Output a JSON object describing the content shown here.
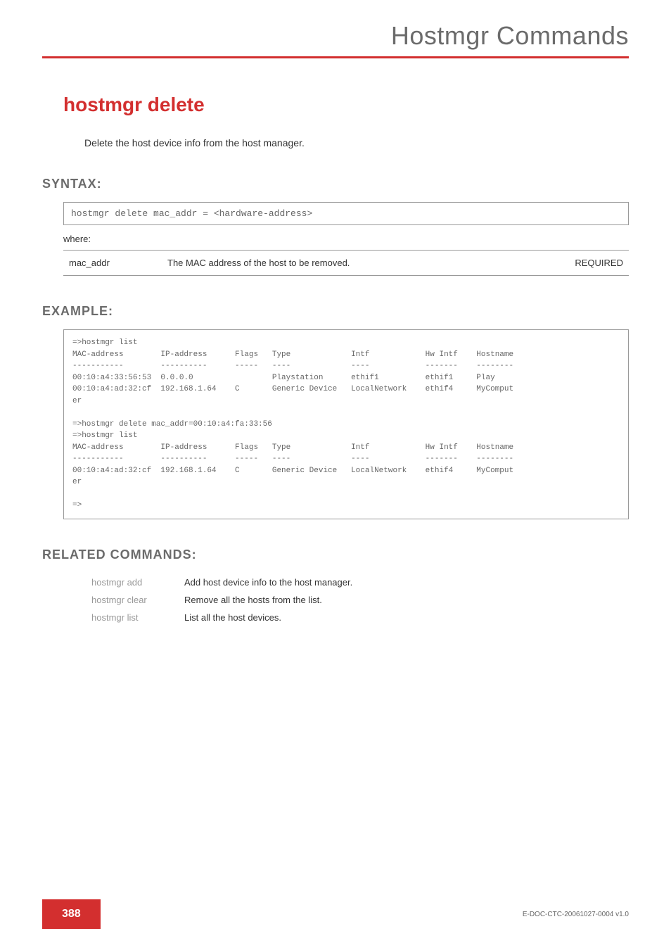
{
  "header": {
    "title": "Hostmgr Commands"
  },
  "command": {
    "title": "hostmgr delete",
    "description": "Delete the host device info from the host manager."
  },
  "syntax": {
    "heading": "SYNTAX:",
    "code": "hostmgr delete   mac_addr = <hardware-address>",
    "where_label": "where:",
    "params": [
      {
        "name": "mac_addr",
        "desc": "The MAC address of the host to be removed.",
        "req": "REQUIRED"
      }
    ]
  },
  "example": {
    "heading": "EXAMPLE:",
    "text": "=>hostmgr list\nMAC-address        IP-address      Flags   Type             Intf            Hw Intf    Hostname\n-----------        ----------      -----   ----             ----            -------    --------\n00:10:a4:33:56:53  0.0.0.0                 Playstation      ethif1          ethif1     Play\n00:10:a4:ad:32:cf  192.168.1.64    C       Generic Device   LocalNetwork    ethif4     MyComput\ner\n\n=>hostmgr delete mac_addr=00:10:a4:fa:33:56\n=>hostmgr list\nMAC-address        IP-address      Flags   Type             Intf            Hw Intf    Hostname\n-----------        ----------      -----   ----             ----            -------    --------\n00:10:a4:ad:32:cf  192.168.1.64    C       Generic Device   LocalNetwork    ethif4     MyComput\ner\n\n=>"
  },
  "related": {
    "heading": "RELATED COMMANDS:",
    "items": [
      {
        "cmd": "hostmgr add",
        "desc": "Add host device info to the host manager."
      },
      {
        "cmd": "hostmgr clear",
        "desc": "Remove all the hosts from the list."
      },
      {
        "cmd": "hostmgr list",
        "desc": "List all the host devices."
      }
    ]
  },
  "footer": {
    "page": "388",
    "docref": "E-DOC-CTC-20061027-0004 v1.0"
  }
}
